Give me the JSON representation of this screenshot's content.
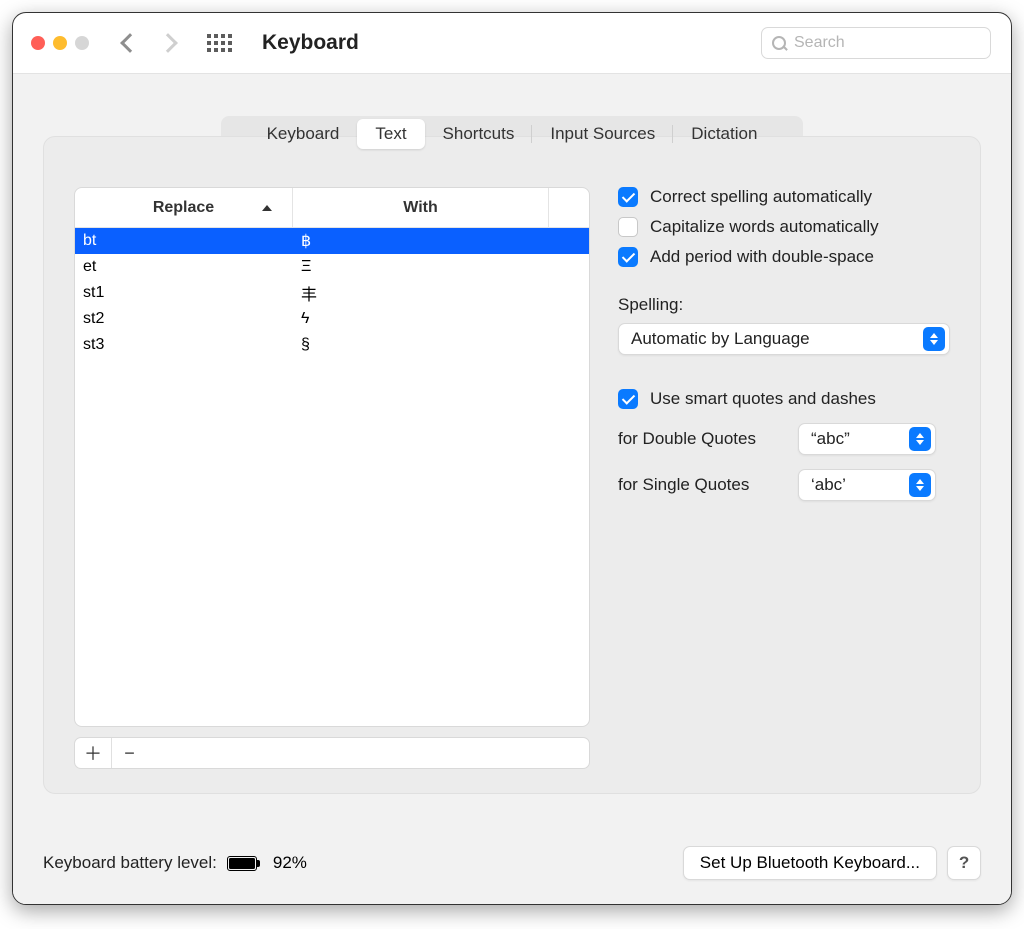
{
  "header": {
    "title": "Keyboard",
    "search_placeholder": "Search"
  },
  "tabs": [
    "Keyboard",
    "Text",
    "Shortcuts",
    "Input Sources",
    "Dictation"
  ],
  "active_tab": "Text",
  "table": {
    "col_replace": "Replace",
    "col_with": "With",
    "rows": [
      {
        "replace": "bt",
        "with": "฿",
        "selected": true
      },
      {
        "replace": "et",
        "with": "Ξ",
        "selected": false
      },
      {
        "replace": "st1",
        "with": "丰",
        "selected": false
      },
      {
        "replace": "st2",
        "with": "ϟ",
        "selected": false
      },
      {
        "replace": "st3",
        "with": "§",
        "selected": false
      }
    ]
  },
  "opts": {
    "correct_spelling": {
      "label": "Correct spelling automatically",
      "checked": true
    },
    "capitalize": {
      "label": "Capitalize words automatically",
      "checked": false
    },
    "add_period": {
      "label": "Add period with double-space",
      "checked": true
    },
    "spelling_label": "Spelling:",
    "spelling_value": "Automatic by Language",
    "smart_quotes": {
      "label": "Use smart quotes and dashes",
      "checked": true
    },
    "double_quotes_label": "for Double Quotes",
    "double_quotes_value": "“abc”",
    "single_quotes_label": "for Single Quotes",
    "single_quotes_value": "‘abc’"
  },
  "footer": {
    "battery_label": "Keyboard battery level:",
    "battery_pct": "92%",
    "bluetooth_button": "Set Up Bluetooth Keyboard...",
    "help": "?"
  }
}
